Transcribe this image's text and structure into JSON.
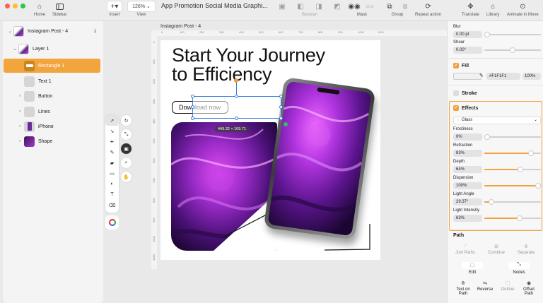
{
  "toolbar": {
    "home": "Home",
    "sidebar": "Sidebar",
    "insert": "Insert",
    "zoom": "126%",
    "view": "View",
    "doc_title": "App Promotion Social Media Graphi...",
    "boolean": "Boolean",
    "mask": "Mask",
    "group": "Group",
    "repeat_action": "Repeat action",
    "translate": "Translate",
    "library": "Library",
    "animate_in_move": "Animate in Move"
  },
  "layers": {
    "artboard": "Instagram Post - 4",
    "items": [
      {
        "name": "Layer 1"
      },
      {
        "name": "Rectangle 1"
      },
      {
        "name": "Text 1"
      },
      {
        "name": "Button"
      },
      {
        "name": "Lines"
      },
      {
        "name": "iPhone"
      },
      {
        "name": "Shape"
      }
    ]
  },
  "canvas": {
    "artboard_label": "Instagram Post - 4",
    "headline_1": "Start Your Journey",
    "headline_2": "to Efficiency",
    "cta": "Download now",
    "size_badge": "449.32 × 109.71",
    "ruler_h": [
      "0",
      "100",
      "200",
      "300",
      "400",
      "500",
      "600",
      "700",
      "800",
      "900",
      "1000",
      "1100"
    ],
    "ruler_v": [
      "0",
      "100",
      "200",
      "300",
      "400",
      "500",
      "600",
      "700",
      "800",
      "900",
      "1000",
      "1080"
    ]
  },
  "inspector": {
    "blur_label": "Blur",
    "blur_value": "0.00 pt",
    "shear_label": "Shear",
    "shear_value": "0.00°",
    "fill_label": "Fill",
    "fill_hex": "#F1F1F1",
    "fill_opacity": "100%",
    "stroke_label": "Stroke",
    "effects_label": "Effects",
    "effect_type": "Glass",
    "params": [
      {
        "label": "Frostiness",
        "value": "0%",
        "level": 0.0
      },
      {
        "label": "Refraction",
        "value": "83%",
        "level": 0.83
      },
      {
        "label": "Depth",
        "value": "64%",
        "level": 0.64
      },
      {
        "label": "Dispersion",
        "value": "100%",
        "level": 1.0
      },
      {
        "label": "Light Angle",
        "value": "29.37°",
        "level": 0.12
      },
      {
        "label": "Light Intensity",
        "value": "63%",
        "level": 0.63
      }
    ],
    "path_label": "Path",
    "join_paths": "Join Paths",
    "combine": "Combine",
    "separate": "Separate",
    "edit": "Edit",
    "nodes": "Nodes",
    "text_on_path": "Text on Path",
    "reverse": "Reverse",
    "outline": "Outline",
    "offset_path": "Offset Path"
  },
  "colors": {
    "accent": "#F0A240",
    "selection": "#3B7DDD"
  }
}
